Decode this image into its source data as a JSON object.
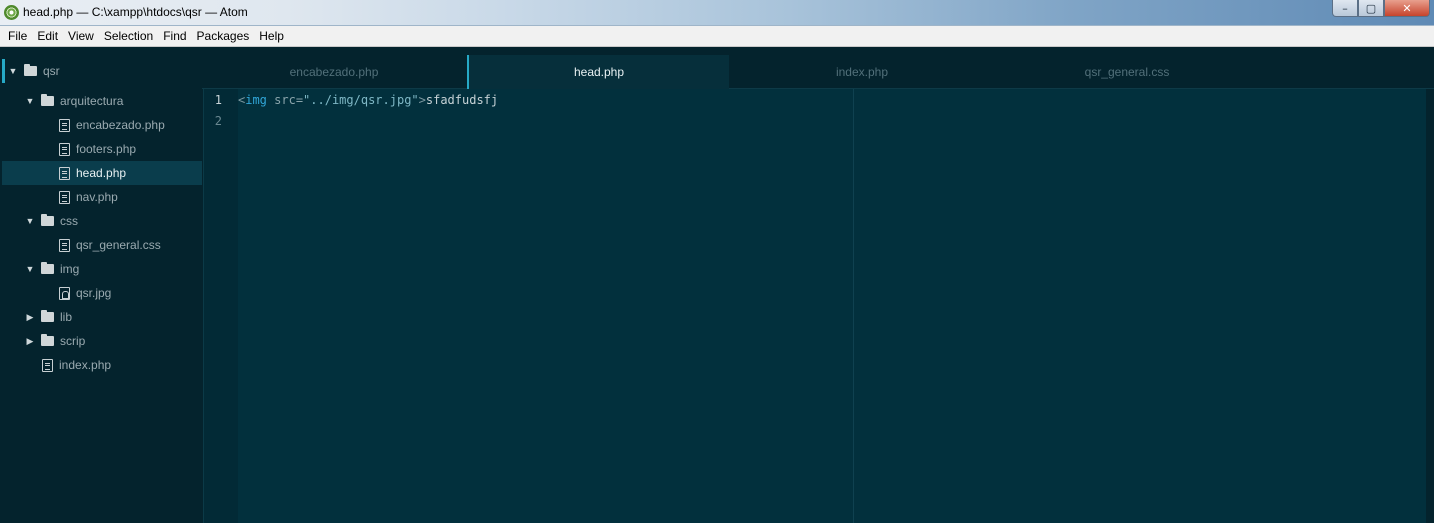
{
  "window": {
    "title": "head.php — C:\\xampp\\htdocs\\qsr — Atom",
    "minimize_glyph": "–",
    "maximize_glyph": "▢",
    "close_glyph": "✕"
  },
  "menu": [
    "File",
    "Edit",
    "View",
    "Selection",
    "Find",
    "Packages",
    "Help"
  ],
  "tree": {
    "root": "qsr",
    "items": [
      {
        "label": "arquitectura",
        "type": "folder",
        "expanded": true,
        "depth": 1
      },
      {
        "label": "encabezado.php",
        "type": "file",
        "depth": 2
      },
      {
        "label": "footers.php",
        "type": "file",
        "depth": 2
      },
      {
        "label": "head.php",
        "type": "file",
        "depth": 2,
        "selected": true
      },
      {
        "label": "nav.php",
        "type": "file",
        "depth": 2
      },
      {
        "label": "css",
        "type": "folder",
        "expanded": true,
        "depth": 1
      },
      {
        "label": "qsr_general.css",
        "type": "file",
        "depth": 2
      },
      {
        "label": "img",
        "type": "folder",
        "expanded": true,
        "depth": 1
      },
      {
        "label": "qsr.jpg",
        "type": "image",
        "depth": 2
      },
      {
        "label": "lib",
        "type": "folder",
        "expanded": false,
        "depth": 1
      },
      {
        "label": "scrip",
        "type": "folder",
        "expanded": false,
        "depth": 1
      },
      {
        "label": "index.php",
        "type": "file",
        "depth": 1
      }
    ]
  },
  "tabs": [
    {
      "label": "encabezado.php",
      "active": false
    },
    {
      "label": "head.php",
      "active": true
    },
    {
      "label": "index.php",
      "active": false
    },
    {
      "label": "qsr_general.css",
      "active": false
    }
  ],
  "editor": {
    "line_numbers": [
      "1",
      "2"
    ],
    "line1": {
      "open": "<",
      "tag": "img",
      "attr": " src=",
      "value": "\"../img/qsr.jpg\"",
      "close": ">",
      "text": "sfadfudsfj"
    }
  },
  "colors": {
    "background": "#04232d",
    "editor": "#02303d",
    "accent": "#26a9c6",
    "tag": "#31a6d8"
  }
}
